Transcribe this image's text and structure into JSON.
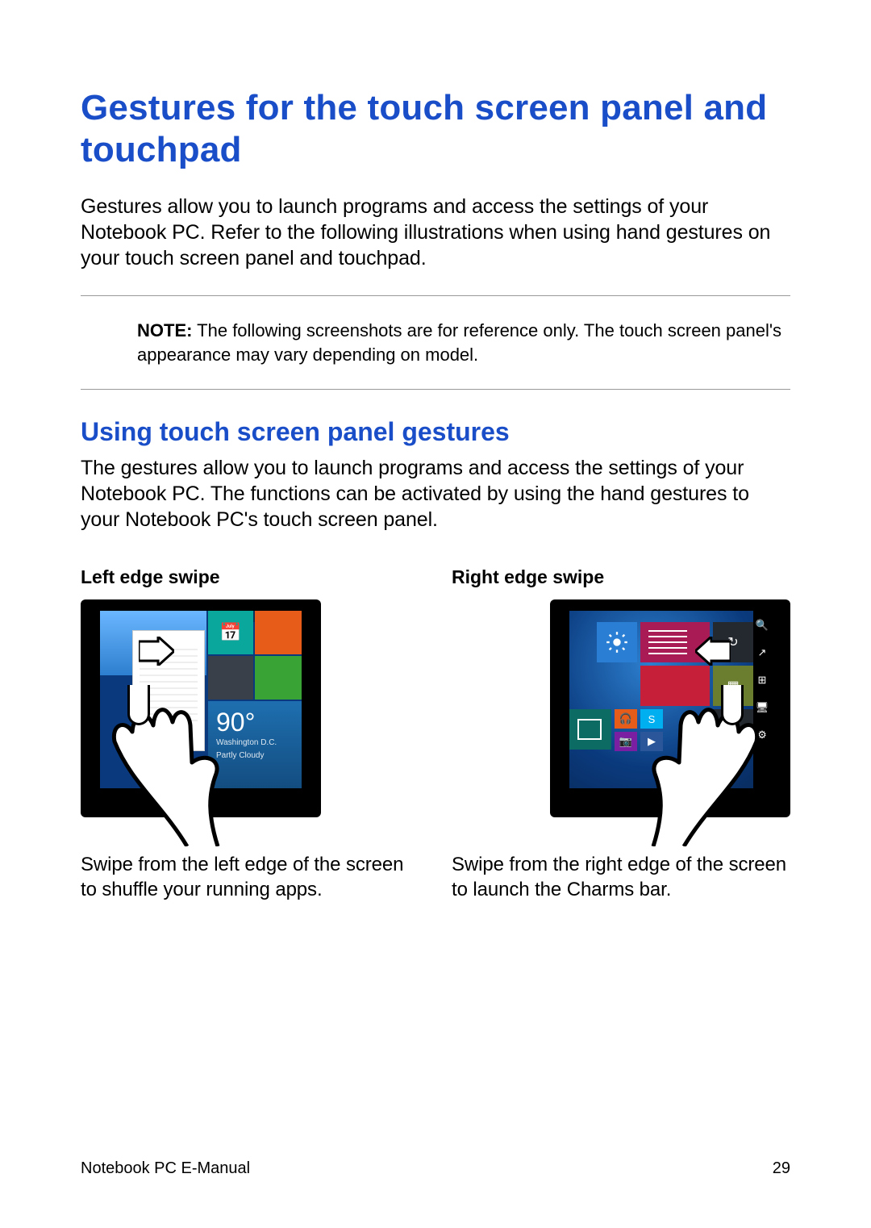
{
  "heading1": "Gestures for the touch screen panel and touchpad",
  "intro": "Gestures allow you to launch programs and access the settings of your Notebook PC. Refer to the following illustrations when using hand gestures on your touch screen panel and touchpad.",
  "note": {
    "label": "NOTE:",
    "text": " The following screenshots are for reference only. The touch screen panel's appearance may vary depending on model."
  },
  "heading2": "Using touch screen panel gestures",
  "sub_intro": "The gestures allow you to launch programs and access the settings of your Notebook PC. The functions can be activated by using the hand gestures to your Notebook PC's touch screen panel.",
  "gestures": {
    "left": {
      "title": "Left edge swipe",
      "desc": "Swipe from the left edge of the screen to shuffle your running apps."
    },
    "right": {
      "title": "Right edge swipe",
      "desc": "Swipe from the right edge of the screen to launch the Charms bar."
    }
  },
  "weather": {
    "deg": "90°",
    "city": "Washington D.C.",
    "cond": "Partly Cloudy"
  },
  "footer": {
    "left": "Notebook PC E-Manual",
    "page": "29"
  }
}
